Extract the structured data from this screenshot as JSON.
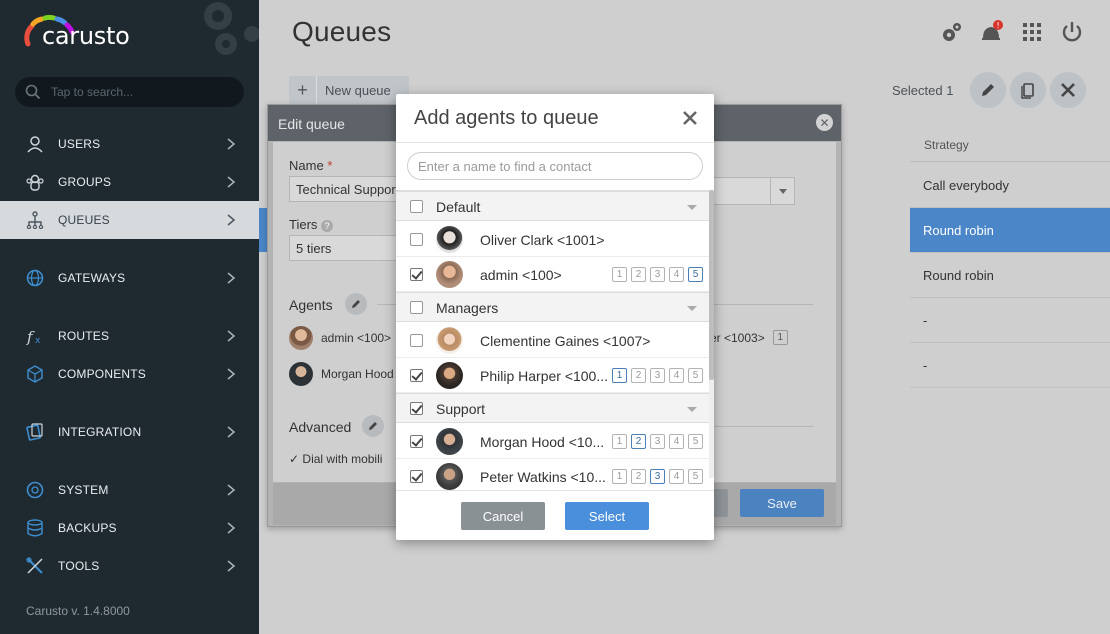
{
  "app": {
    "logo_text": "carusto",
    "version": "Carusto v. 1.4.8000"
  },
  "sidebar": {
    "search_placeholder": "Tap to search...",
    "items": [
      {
        "label": "USERS",
        "icon": "user-icon"
      },
      {
        "label": "GROUPS",
        "icon": "group-icon"
      },
      {
        "label": "QUEUES",
        "icon": "queue-icon",
        "active": true
      },
      {
        "label": "GATEWAYS",
        "icon": "globe-icon"
      },
      {
        "label": "ROUTES",
        "icon": "function-icon"
      },
      {
        "label": "COMPONENTS",
        "icon": "cube-icon"
      },
      {
        "label": "INTEGRATION",
        "icon": "integration-icon"
      },
      {
        "label": "SYSTEM",
        "icon": "system-icon"
      },
      {
        "label": "BACKUPS",
        "icon": "database-icon"
      },
      {
        "label": "TOOLS",
        "icon": "tools-icon"
      }
    ]
  },
  "header": {
    "title": "Queues",
    "new_queue_label": "New queue",
    "selected_text": "Selected 1"
  },
  "table": {
    "strategy_header": "Strategy",
    "rows": [
      "Call everybody",
      "Round robin",
      "Round robin",
      "-",
      "-"
    ]
  },
  "edit_panel": {
    "title": "Edit queue",
    "name_label": "Name",
    "required_mark": "*",
    "name_value": "Technical Support",
    "tiers_label": "Tiers",
    "tiers_value": "5 tiers",
    "agents_label": "Agents",
    "agent1": "admin <100>",
    "agent2": "Morgan Hood",
    "agent3_partial": "er <1003>",
    "agent3_tier": "1",
    "advanced_label": "Advanced",
    "dial_mobile": "Dial with mobili",
    "save_label": "Save"
  },
  "modal": {
    "title": "Add agents to queue",
    "search_placeholder": "Enter a name to find a contact",
    "groups": [
      {
        "label": "Default",
        "checked": false
      },
      {
        "label": "Managers",
        "checked": false
      },
      {
        "label": "Support",
        "checked": true
      }
    ],
    "contacts": [
      {
        "name": "Oliver Clark <1001>",
        "checked": false,
        "tier": 0
      },
      {
        "name": "admin <100>",
        "checked": true,
        "tier": 5
      },
      {
        "name": "Clementine Gaines <1007>",
        "checked": false,
        "tier": 0
      },
      {
        "name": "Philip Harper <100...",
        "checked": true,
        "tier": 1
      },
      {
        "name": "Morgan Hood <10...",
        "checked": true,
        "tier": 2
      },
      {
        "name": "Peter Watkins <10...",
        "checked": true,
        "tier": 3
      }
    ],
    "tier_labels": [
      "1",
      "2",
      "3",
      "4",
      "5"
    ],
    "cancel_label": "Cancel",
    "select_label": "Select"
  },
  "colors": {
    "sidebar_bg": "#1f2930",
    "accent": "#4a86c8",
    "select_button": "#4a8fdc",
    "cancel_button": "#8a9195"
  }
}
